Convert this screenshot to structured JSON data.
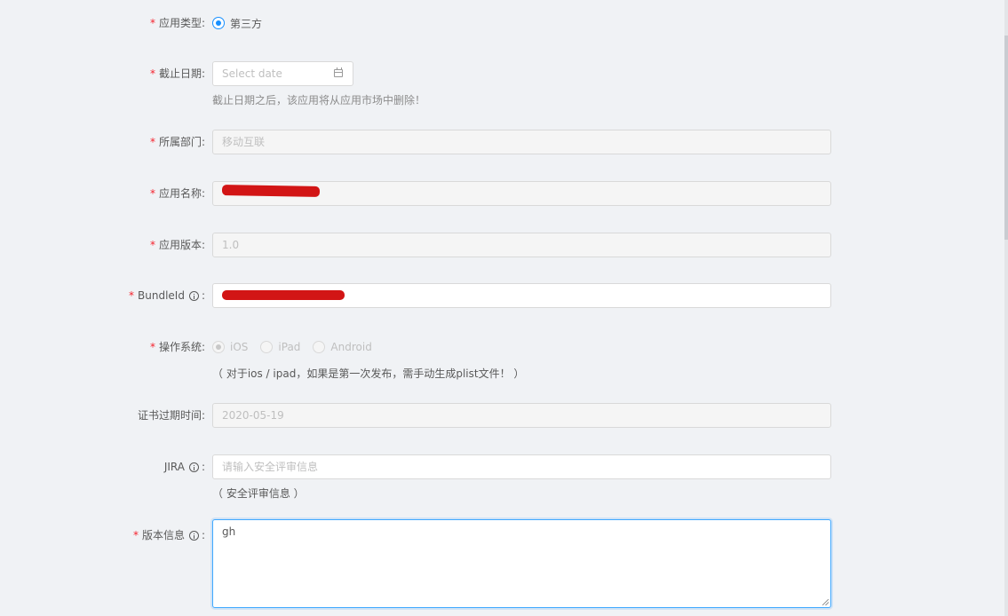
{
  "form": {
    "app_type": {
      "label": "应用类型:",
      "required": "*",
      "options": [
        {
          "label": "第三方",
          "checked": true
        }
      ]
    },
    "deadline": {
      "label": "截止日期:",
      "required": "*",
      "placeholder": "Select date",
      "icon": "calendar-icon",
      "help": "截止日期之后，该应用将从应用市场中删除！"
    },
    "department": {
      "label": "所属部门:",
      "required": "*",
      "value": "移动互联"
    },
    "app_name": {
      "label": "应用名称:",
      "required": "*",
      "value": ""
    },
    "app_version": {
      "label": "应用版本:",
      "required": "*",
      "value": "1.0"
    },
    "bundle_id": {
      "label": "BundleId",
      "required": "*",
      "colon": ":",
      "icon": "info-circle-icon",
      "value": ""
    },
    "os": {
      "label": "操作系统:",
      "required": "*",
      "options": [
        {
          "label": "iOS",
          "checked": true
        },
        {
          "label": "iPad",
          "checked": false
        },
        {
          "label": "Android",
          "checked": false
        }
      ],
      "help": "（ 对于ios / ipad，如果是第一次发布，需手动生成plist文件！ ）"
    },
    "cert_expiry": {
      "label": "证书过期时间:",
      "value": "2020-05-19"
    },
    "jira": {
      "label": "JIRA",
      "colon": ":",
      "icon": "info-circle-icon",
      "placeholder": "请输入安全评审信息",
      "help": "（ 安全评审信息 ）"
    },
    "version_info": {
      "label": "版本信息",
      "required": "*",
      "colon": ":",
      "icon": "info-circle-icon",
      "value": "gh"
    }
  },
  "colors": {
    "accent": "#1890ff",
    "required": "#f5222d",
    "redaction": "#d21515",
    "background": "#f0f2f5"
  }
}
